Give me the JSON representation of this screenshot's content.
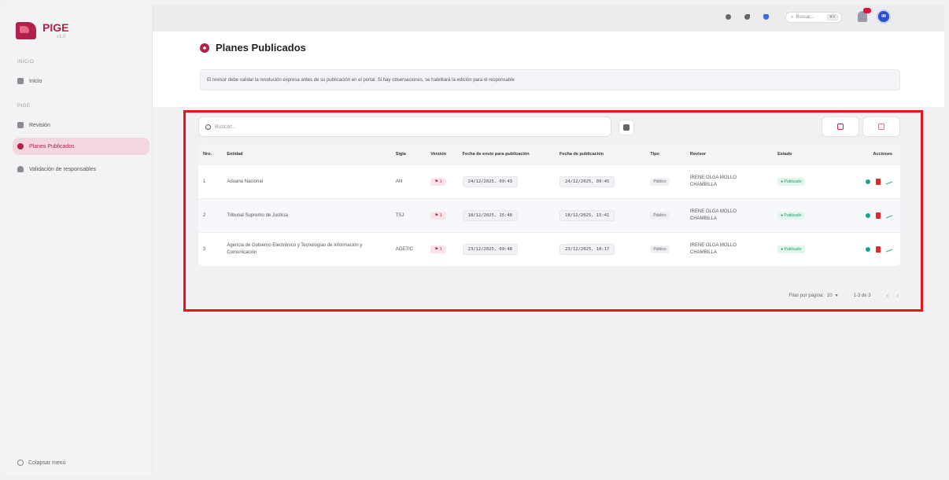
{
  "sidebar": {
    "brand": "PIGE",
    "version": "v1.0",
    "section_inicio": "INICIO",
    "section_pige": "PIGE",
    "items": [
      {
        "label": "Inicio"
      },
      {
        "label": "Revisión"
      },
      {
        "label": "Planes Publicados"
      },
      {
        "label": "Validación de responsables"
      }
    ],
    "collapse_label": "Colapsar menú"
  },
  "topbar": {
    "search_placeholder": "Buscar...",
    "search_shortcut": "⌘K",
    "avatar_initials": "IM"
  },
  "page": {
    "title": "Planes Publicados",
    "info": "El revisor debe validar la resolución expresa antes de su publicación en el portal. Si hay observaciones, se habilitará la edición para el responsable"
  },
  "table": {
    "search_placeholder": "Buscar...",
    "headers": [
      "Nro.",
      "Entidad",
      "Sigla",
      "Versión",
      "Fecha de envío para publicación",
      "Fecha de publicación",
      "Tipo",
      "Revisor",
      "Estado",
      "Acciones"
    ],
    "rows": [
      {
        "nro": "1",
        "entidad": "Aduana Nacional",
        "sigla": "AN",
        "version": "1",
        "envio": "24/12/2025, 09:43",
        "publicacion": "24/12/2025, 09:45",
        "tipo": "Público",
        "revisor": "IRENE OLGA MOLLO CHAMBILLA",
        "estado": "Publicado"
      },
      {
        "nro": "2",
        "entidad": "Tribunal Supremo de Justicia",
        "sigla": "TSJ",
        "version": "1",
        "envio": "18/12/2025, 15:40",
        "publicacion": "18/12/2025, 15:41",
        "tipo": "Público",
        "revisor": "IRENE OLGA MOLLO CHAMBILLA",
        "estado": "Publicado"
      },
      {
        "nro": "3",
        "entidad": "Agencia de Gobierno Electrónico y Tecnologías de Información y Comunicación",
        "sigla": "AGETIC",
        "version": "1",
        "envio": "23/12/2025, 09:48",
        "publicacion": "23/12/2025, 10:17",
        "tipo": "Público",
        "revisor": "IRENE OLGA MOLLO CHAMBILLA",
        "estado": "Publicado"
      }
    ]
  },
  "pagination": {
    "rows_label": "Filas por página:",
    "rows_value": "10",
    "range": "1-3 de 3"
  },
  "colors": {
    "brand": "#b0224a",
    "highlight": "#e8141a",
    "status": "#1f9e6a"
  }
}
